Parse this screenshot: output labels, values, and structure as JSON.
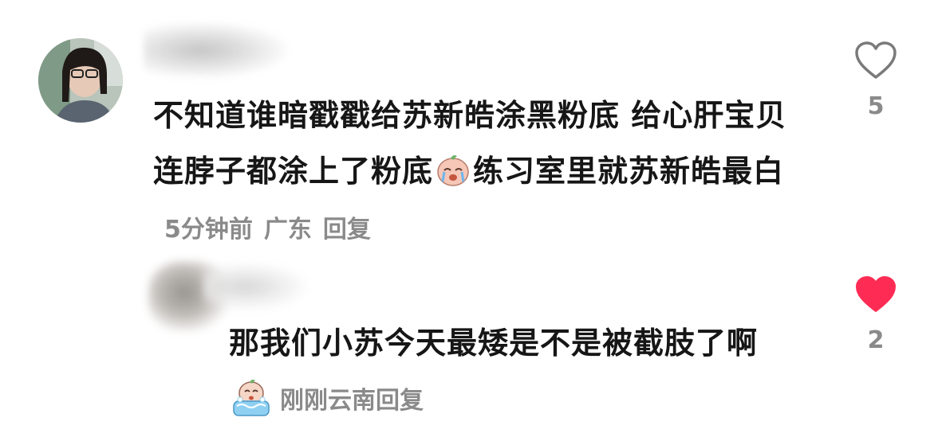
{
  "comment": {
    "text_part1": "不知道谁暗戳戳给苏新皓涂黑粉底 给心肝宝贝连脖子都涂上了粉底",
    "text_part2": "练习室里就苏新皓最白",
    "emoji_1": "crying-face-emoji",
    "time": "5分钟前",
    "location": "广东",
    "reply_label": "回复",
    "like_count": "5",
    "liked": false
  },
  "reply": {
    "text": "那我们小苏今天最矮是不是被截肢了啊",
    "emoji": "crying-bath-emoji",
    "time": "刚刚",
    "location": "云南",
    "reply_label": "回复",
    "like_count": "2",
    "liked": true
  },
  "colors": {
    "heart_liked": "#fe2c55",
    "heart_outline": "#7a7a7a",
    "meta_text": "#8a8a8a",
    "body_text": "#161616"
  }
}
